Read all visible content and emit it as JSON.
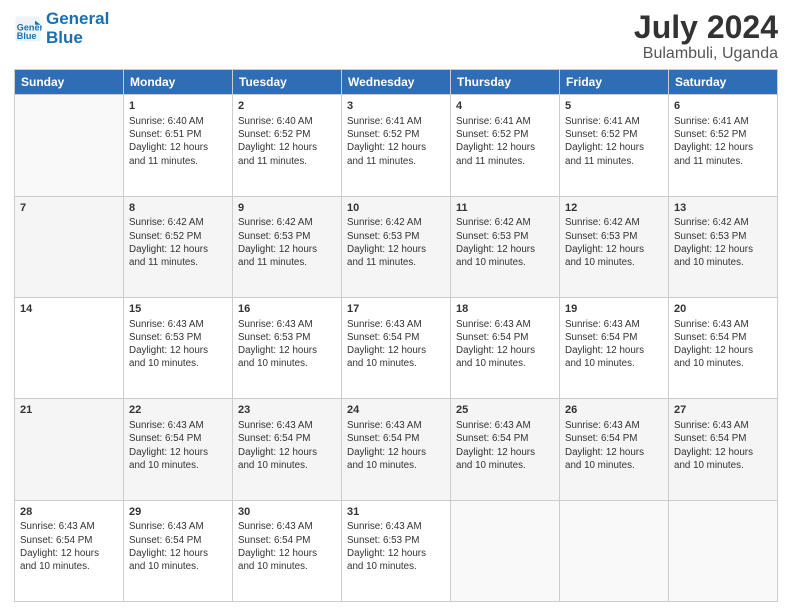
{
  "logo": {
    "line1": "General",
    "line2": "Blue"
  },
  "title": "July 2024",
  "location": "Bulambuli, Uganda",
  "days_of_week": [
    "Sunday",
    "Monday",
    "Tuesday",
    "Wednesday",
    "Thursday",
    "Friday",
    "Saturday"
  ],
  "weeks": [
    [
      {
        "day": "",
        "info": ""
      },
      {
        "day": "1",
        "info": "Sunrise: 6:40 AM\nSunset: 6:51 PM\nDaylight: 12 hours\nand 11 minutes."
      },
      {
        "day": "2",
        "info": "Sunrise: 6:40 AM\nSunset: 6:52 PM\nDaylight: 12 hours\nand 11 minutes."
      },
      {
        "day": "3",
        "info": "Sunrise: 6:41 AM\nSunset: 6:52 PM\nDaylight: 12 hours\nand 11 minutes."
      },
      {
        "day": "4",
        "info": "Sunrise: 6:41 AM\nSunset: 6:52 PM\nDaylight: 12 hours\nand 11 minutes."
      },
      {
        "day": "5",
        "info": "Sunrise: 6:41 AM\nSunset: 6:52 PM\nDaylight: 12 hours\nand 11 minutes."
      },
      {
        "day": "6",
        "info": "Sunrise: 6:41 AM\nSunset: 6:52 PM\nDaylight: 12 hours\nand 11 minutes."
      }
    ],
    [
      {
        "day": "7",
        "info": ""
      },
      {
        "day": "8",
        "info": "Sunrise: 6:42 AM\nSunset: 6:52 PM\nDaylight: 12 hours\nand 11 minutes."
      },
      {
        "day": "9",
        "info": "Sunrise: 6:42 AM\nSunset: 6:53 PM\nDaylight: 12 hours\nand 11 minutes."
      },
      {
        "day": "10",
        "info": "Sunrise: 6:42 AM\nSunset: 6:53 PM\nDaylight: 12 hours\nand 11 minutes."
      },
      {
        "day": "11",
        "info": "Sunrise: 6:42 AM\nSunset: 6:53 PM\nDaylight: 12 hours\nand 10 minutes."
      },
      {
        "day": "12",
        "info": "Sunrise: 6:42 AM\nSunset: 6:53 PM\nDaylight: 12 hours\nand 10 minutes."
      },
      {
        "day": "13",
        "info": "Sunrise: 6:42 AM\nSunset: 6:53 PM\nDaylight: 12 hours\nand 10 minutes."
      }
    ],
    [
      {
        "day": "14",
        "info": ""
      },
      {
        "day": "15",
        "info": "Sunrise: 6:43 AM\nSunset: 6:53 PM\nDaylight: 12 hours\nand 10 minutes."
      },
      {
        "day": "16",
        "info": "Sunrise: 6:43 AM\nSunset: 6:53 PM\nDaylight: 12 hours\nand 10 minutes."
      },
      {
        "day": "17",
        "info": "Sunrise: 6:43 AM\nSunset: 6:54 PM\nDaylight: 12 hours\nand 10 minutes."
      },
      {
        "day": "18",
        "info": "Sunrise: 6:43 AM\nSunset: 6:54 PM\nDaylight: 12 hours\nand 10 minutes."
      },
      {
        "day": "19",
        "info": "Sunrise: 6:43 AM\nSunset: 6:54 PM\nDaylight: 12 hours\nand 10 minutes."
      },
      {
        "day": "20",
        "info": "Sunrise: 6:43 AM\nSunset: 6:54 PM\nDaylight: 12 hours\nand 10 minutes."
      }
    ],
    [
      {
        "day": "21",
        "info": ""
      },
      {
        "day": "22",
        "info": "Sunrise: 6:43 AM\nSunset: 6:54 PM\nDaylight: 12 hours\nand 10 minutes."
      },
      {
        "day": "23",
        "info": "Sunrise: 6:43 AM\nSunset: 6:54 PM\nDaylight: 12 hours\nand 10 minutes."
      },
      {
        "day": "24",
        "info": "Sunrise: 6:43 AM\nSunset: 6:54 PM\nDaylight: 12 hours\nand 10 minutes."
      },
      {
        "day": "25",
        "info": "Sunrise: 6:43 AM\nSunset: 6:54 PM\nDaylight: 12 hours\nand 10 minutes."
      },
      {
        "day": "26",
        "info": "Sunrise: 6:43 AM\nSunset: 6:54 PM\nDaylight: 12 hours\nand 10 minutes."
      },
      {
        "day": "27",
        "info": "Sunrise: 6:43 AM\nSunset: 6:54 PM\nDaylight: 12 hours\nand 10 minutes."
      }
    ],
    [
      {
        "day": "28",
        "info": "Sunrise: 6:43 AM\nSunset: 6:54 PM\nDaylight: 12 hours\nand 10 minutes."
      },
      {
        "day": "29",
        "info": "Sunrise: 6:43 AM\nSunset: 6:54 PM\nDaylight: 12 hours\nand 10 minutes."
      },
      {
        "day": "30",
        "info": "Sunrise: 6:43 AM\nSunset: 6:54 PM\nDaylight: 12 hours\nand 10 minutes."
      },
      {
        "day": "31",
        "info": "Sunrise: 6:43 AM\nSunset: 6:53 PM\nDaylight: 12 hours\nand 10 minutes."
      },
      {
        "day": "",
        "info": ""
      },
      {
        "day": "",
        "info": ""
      },
      {
        "day": "",
        "info": ""
      }
    ]
  ]
}
